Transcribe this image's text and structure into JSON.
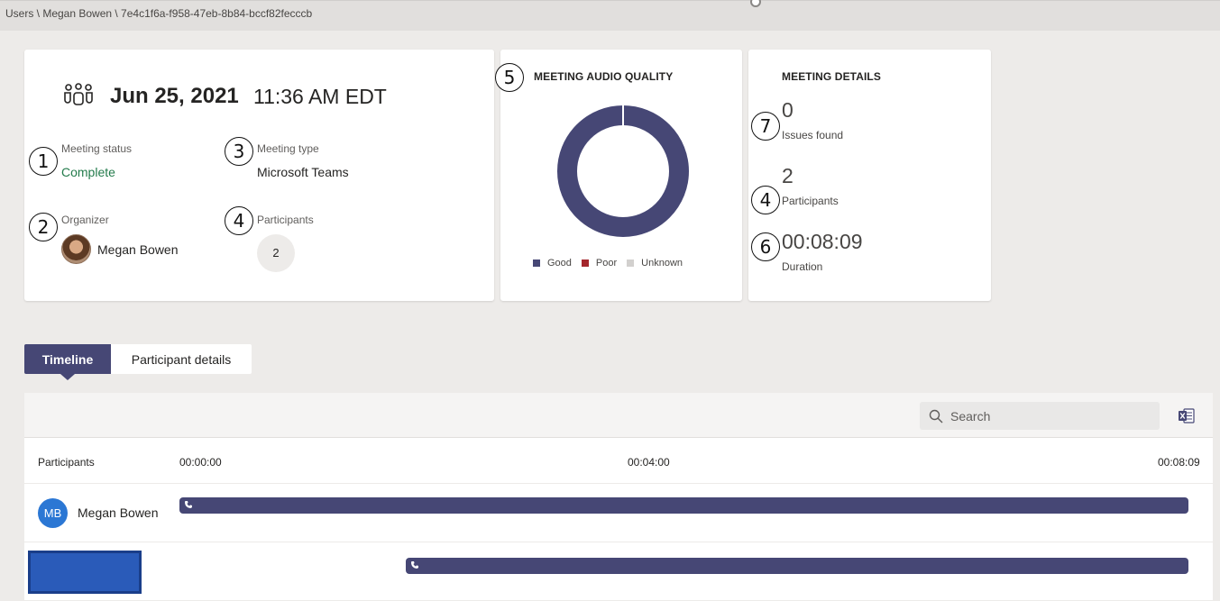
{
  "breadcrumb": "Users \\ Megan Bowen \\ 7e4c1f6a-f958-47eb-8b84-bccf82fecccb",
  "summary": {
    "date": "Jun 25, 2021",
    "time": "11:36 AM EDT",
    "meeting_status_label": "Meeting status",
    "meeting_status_value": "Complete",
    "meeting_type_label": "Meeting type",
    "meeting_type_value": "Microsoft Teams",
    "organizer_label": "Organizer",
    "organizer_name": "Megan Bowen",
    "participants_label": "Participants",
    "participants_count": "2"
  },
  "audio": {
    "title": "MEETING AUDIO QUALITY",
    "legend": [
      "Good",
      "Poor",
      "Unknown"
    ],
    "colors": {
      "good": "#464775",
      "poor": "#a4262c",
      "unknown": "#d2d0ce"
    }
  },
  "details": {
    "title": "MEETING DETAILS",
    "issues_value": "0",
    "issues_label": "Issues found",
    "participants_value": "2",
    "participants_label": "Participants",
    "duration_value": "00:08:09",
    "duration_label": "Duration"
  },
  "callouts": [
    "1",
    "2",
    "3",
    "4",
    "5",
    "7",
    "4",
    "6"
  ],
  "tabs": [
    "Timeline",
    "Participant details"
  ],
  "search": {
    "placeholder": "Search"
  },
  "timeline": {
    "header": "Participants",
    "ticks": [
      "00:00:00",
      "00:04:00",
      "00:08:09"
    ],
    "rows": [
      {
        "initials": "MB",
        "name": "Megan Bowen",
        "start_fraction": 0.0,
        "end_fraction": 1.0
      },
      {
        "initials": "",
        "name": "",
        "start_fraction": 0.224,
        "end_fraction": 1.0
      }
    ]
  },
  "theme": {
    "accent": "#464775",
    "status_green": "#237b4b"
  }
}
